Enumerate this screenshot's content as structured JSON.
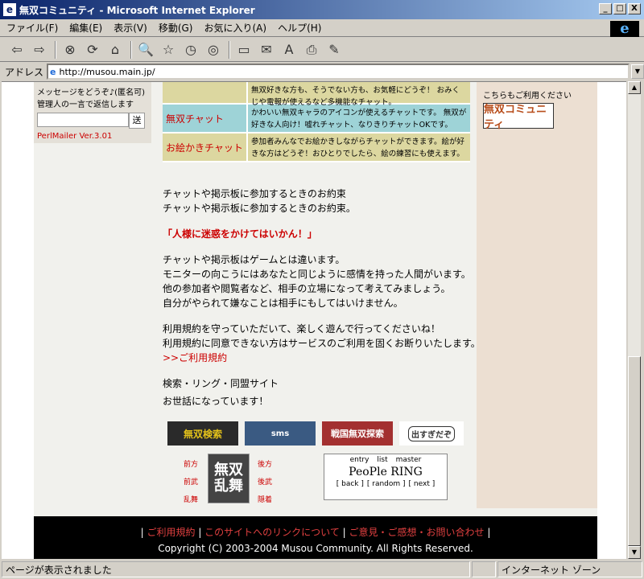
{
  "window": {
    "title": "無双コミュニティ - Microsoft Internet Explorer",
    "min": "_",
    "max": "□",
    "close": "X"
  },
  "menu": [
    "ファイル(F)",
    "編集(E)",
    "表示(V)",
    "移動(G)",
    "お気に入り(A)",
    "ヘルプ(H)"
  ],
  "toolbar": {
    "back": "⇦",
    "forward": "⇨",
    "stop": "⊗",
    "refresh": "⟳",
    "home": "⌂",
    "search": "🔍",
    "favorites": "☆",
    "history": "◷",
    "channels": "◎",
    "fullscreen": "▭",
    "mail": "✉",
    "print": "⎙",
    "edit": "✎",
    "font": "A"
  },
  "address": {
    "label": "アドレス",
    "url": "http://musou.main.jp/"
  },
  "status": {
    "text": "ページが表示されました",
    "zone": "インターネット ゾーン"
  },
  "left": {
    "line1": "メッセージをどうぞ♪(匿名可)",
    "line2": "管理人の一言で返信します",
    "send": "送",
    "mailer": "PerlMailer Ver.3.01"
  },
  "right": {
    "text": "こちらもご利用ください",
    "banner": "無双コミュニティ"
  },
  "chat_table": [
    {
      "name": "",
      "desc": "無双好きな方も、そうでない方も、お気軽にどうぞ！ おみくじや電報が使えるなど多機能なチャット。",
      "bg": "#dcd7a0"
    },
    {
      "name": "無双チャット",
      "desc": "かわいい無双キャラのアイコンが使えるチャットです。 無双が好きな人向け！嘘れチャット、なりきりチャットOKです。",
      "bg": "#9ed3d7"
    },
    {
      "name": "お絵かきチャット",
      "desc": "参加者みんなでお絵かきしながらチャットができます。絵が好きな方はどうぞ！おひとりでしたら、絵の練習にも使えます。",
      "bg": "#dcd7a0"
    }
  ],
  "main": {
    "h1": "チャットや掲示板に参加するときのお約束",
    "h2": "チャットや掲示板に参加するときのお約束。",
    "warn": "「人様に迷惑をかけてはいかん！」",
    "p1": [
      "チャットや掲示板はゲームとは違います。",
      "モニターの向こうにはあなたと同じように感情を持った人間がいます。",
      "他の参加者や閲覧者など、相手の立場になって考えてみましょう。",
      "自分がやられて嫌なことは相手にもしてはいけません。"
    ],
    "p2": [
      "利用規約を守っていただいて、楽しく遊んで行ってくださいね！",
      "利用規約に同意できない方はサービスのご利用を固くお断りいたします。"
    ],
    "terms_link": ">>ご利用規約",
    "links_title": "検索・リング・同盟サイト",
    "thanks": "お世話になっています！"
  },
  "banners": {
    "b1": "無双検索",
    "b2": "sms",
    "b3": "戦国無双探索",
    "b4": "出すぎだぞ"
  },
  "navgrid": {
    "tl": "前方",
    "ml": "前武",
    "bl": "乱舞",
    "tr": "後方",
    "mr": "後武",
    "br": "隠着",
    "center": "無双乱舞"
  },
  "ring": {
    "entry": "entry",
    "list": "list",
    "master": "master",
    "title": "PeoPle RING",
    "back": "[ back ]",
    "random": "[ random ]",
    "next": "[ next ]"
  },
  "footer": {
    "links": [
      "ご利用規約",
      "このサイトへのリンクについて",
      "ご意見・ご感想・お問い合わせ"
    ],
    "copyright": "Copyright (C) 2003-2004 Musou Community. All Rights Reserved."
  }
}
